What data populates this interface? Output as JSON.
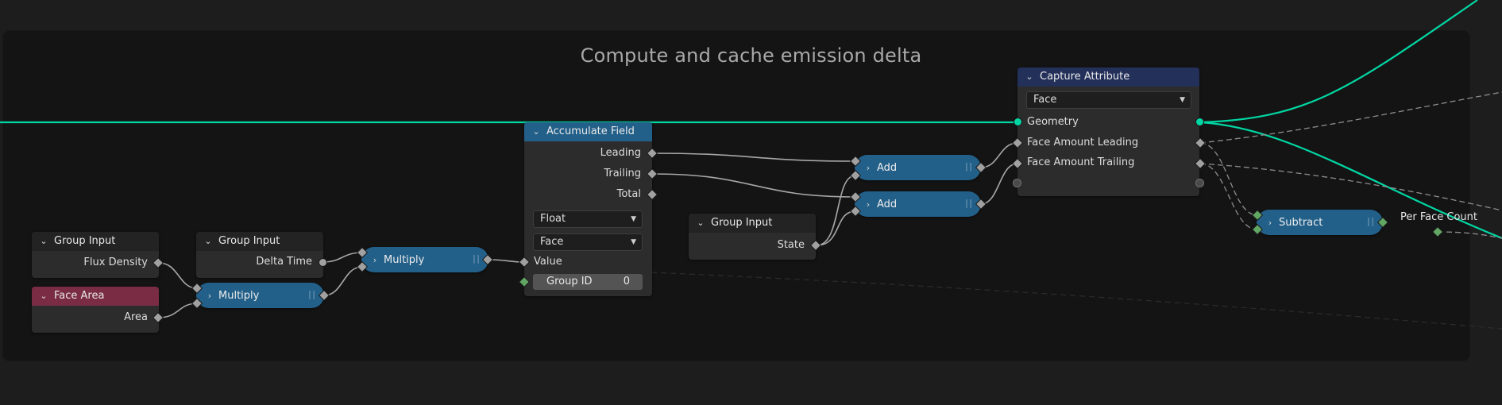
{
  "frame": {
    "title": "Compute and cache emission delta"
  },
  "colors": {
    "geometry_wire": "#00d6a3",
    "float_socket": "#a1a1a1",
    "integer_socket": "#62a663",
    "math_node": "#236089",
    "input_header": "#7a2c45",
    "attribute_header": "#23305a"
  },
  "nodes": {
    "group_input_1": {
      "header": "Group Input",
      "output": "Flux Density"
    },
    "group_input_2": {
      "header": "Group Input",
      "output": "Delta Time"
    },
    "face_area": {
      "header": "Face Area",
      "output": "Area"
    },
    "multiply_1": {
      "label": "Multiply"
    },
    "multiply_2": {
      "label": "Multiply"
    },
    "accumulate_field": {
      "header": "Accumulate Field",
      "outputs": [
        "Leading",
        "Trailing",
        "Total"
      ],
      "data_type": "Float",
      "domain": "Face",
      "input_value": "Value",
      "group_id_label": "Group ID",
      "group_id_value": "0"
    },
    "group_input_3": {
      "header": "Group Input",
      "output": "State"
    },
    "add_1": {
      "label": "Add"
    },
    "add_2": {
      "label": "Add"
    },
    "capture_attribute": {
      "header": "Capture Attribute",
      "domain": "Face",
      "rows": [
        "Geometry",
        "Face Amount Leading",
        "Face Amount Trailing"
      ]
    },
    "subtract": {
      "label": "Subtract"
    },
    "reroute_label": "Per Face Count"
  }
}
